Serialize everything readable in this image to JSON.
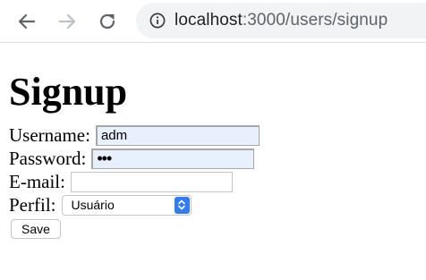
{
  "browser": {
    "url_host": "localhost",
    "url_rest": ":3000/users/signup",
    "icons": {
      "back": "back-arrow-icon",
      "forward": "forward-arrow-icon",
      "reload": "reload-icon",
      "info": "info-icon"
    }
  },
  "page": {
    "title": "Signup",
    "form": {
      "username_label": "Username:",
      "username_value": "adm",
      "password_label": "Password:",
      "password_mask": "•••",
      "email_label": "E-mail:",
      "email_value": "",
      "profile_label": "Perfil:",
      "profile_selected": "Usuário",
      "save_label": "Save"
    }
  },
  "colors": {
    "autofill_background": "#e8f0fe",
    "select_accent": "#2f7cf6",
    "omnibox_background": "#f1f3f4"
  }
}
